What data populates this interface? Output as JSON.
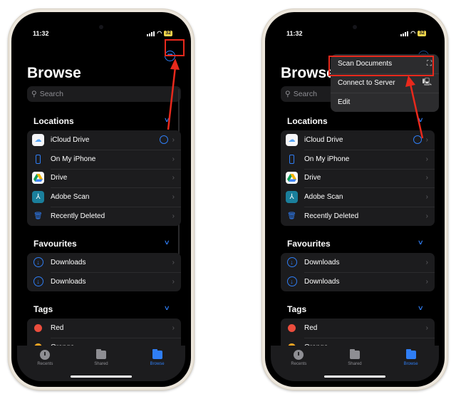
{
  "screens": [
    {
      "status": {
        "time": "11:32",
        "battery": "32"
      },
      "title": "Browse",
      "search": {
        "placeholder": "Search"
      },
      "sections": {
        "locations": {
          "title": "Locations",
          "items": [
            {
              "label": "iCloud Drive",
              "icon": "icloud-icon"
            },
            {
              "label": "On My iPhone",
              "icon": "iphone-icon"
            },
            {
              "label": "Drive",
              "icon": "google-drive-icon"
            },
            {
              "label": "Adobe Scan",
              "icon": "adobe-scan-icon"
            },
            {
              "label": "Recently Deleted",
              "icon": "trash-icon"
            }
          ]
        },
        "favourites": {
          "title": "Favourites",
          "items": [
            {
              "label": "Downloads",
              "icon": "download-icon"
            },
            {
              "label": "Downloads",
              "icon": "download-icon"
            }
          ]
        },
        "tags": {
          "title": "Tags",
          "items": [
            {
              "label": "Red",
              "color": "#eb4d3d"
            },
            {
              "label": "Orange",
              "color": "#f5a623"
            }
          ]
        }
      },
      "tabs": [
        {
          "label": "Recents",
          "active": false
        },
        {
          "label": "Shared",
          "active": false
        },
        {
          "label": "Browse",
          "active": true
        }
      ]
    },
    {
      "menu": {
        "items": [
          {
            "label": "Scan Documents",
            "icon": "scan-icon",
            "glyph": "⛶"
          },
          {
            "label": "Connect to Server",
            "icon": "monitor-icon",
            "glyph": "🖳"
          },
          {
            "label": "Edit",
            "icon": "",
            "glyph": ""
          }
        ]
      }
    }
  ],
  "colors": {
    "accent": "#2f7ef5",
    "highlight": "#e8291c"
  }
}
